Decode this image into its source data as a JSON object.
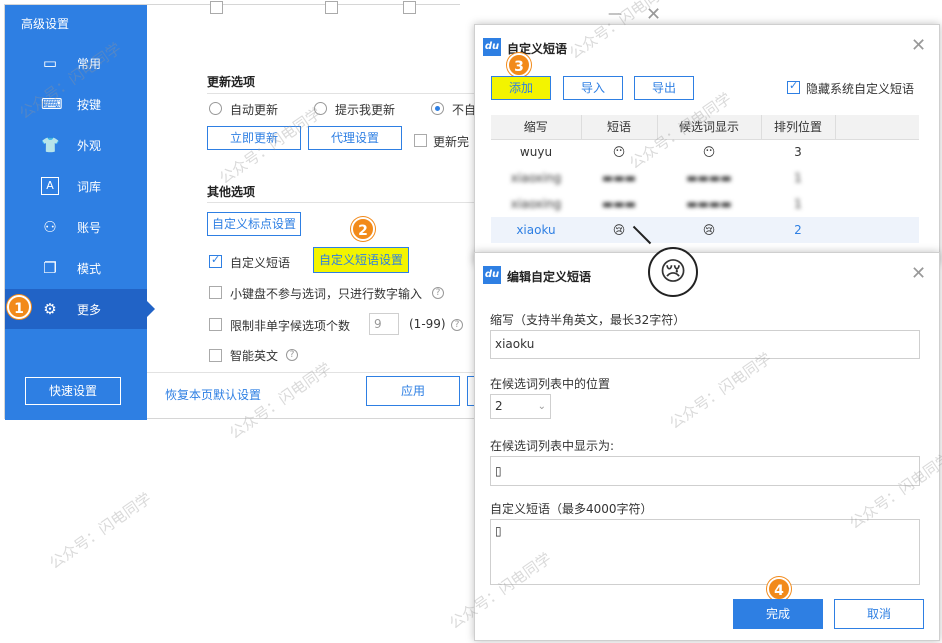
{
  "sidebar": {
    "title": "高级设置",
    "items": [
      {
        "label": "常用",
        "icon": "monitor-icon"
      },
      {
        "label": "按键",
        "icon": "keyboard-icon"
      },
      {
        "label": "外观",
        "icon": "shirt-icon"
      },
      {
        "label": "词库",
        "icon": "dictionary-icon"
      },
      {
        "label": "账号",
        "icon": "user-icon"
      },
      {
        "label": "模式",
        "icon": "mode-icon"
      },
      {
        "label": "更多",
        "icon": "gear-icon"
      }
    ],
    "quick_settings": "快速设置"
  },
  "update": {
    "title": "更新选项",
    "opt_auto": "自动更新",
    "opt_prompt": "提示我更新",
    "opt_no": "不自",
    "update_now": "立即更新",
    "proxy": "代理设置",
    "update_done": "更新完"
  },
  "other": {
    "title": "其他选项",
    "punct_btn": "自定义标点设置",
    "custom_phrase": "自定义短语",
    "custom_phrase_btn": "自定义短语设置",
    "keypad": "小键盘不参与选词，只进行数字输入",
    "limit": "限制非单字候选项个数",
    "limit_value": "9",
    "limit_range": "(1-99)",
    "smart_en": "智能英文"
  },
  "footer": {
    "restore": "恢复本页默认设置",
    "apply": "应用"
  },
  "phrase_dialog": {
    "logo": "du",
    "title": "自定义短语",
    "add": "添加",
    "import": "导入",
    "export": "导出",
    "hide_system": "隐藏系统自定义短语",
    "columns": [
      "缩写",
      "短语",
      "候选词显示",
      "排列位置"
    ],
    "rows": [
      {
        "abbr": "wuyu",
        "phrase": "😶",
        "display": "😶",
        "pos": "3"
      },
      {
        "abbr": "xiaoxing",
        "phrase": "",
        "display": "",
        "pos": "1"
      },
      {
        "abbr": "xiaoxing",
        "phrase": "",
        "display": "",
        "pos": "1"
      },
      {
        "abbr": "xiaoku",
        "phrase": "😢",
        "display": "😢",
        "pos": "2"
      }
    ]
  },
  "edit_dialog": {
    "logo": "du",
    "title": "编辑自定义短语",
    "abbr_label": "缩写（支持半角英文，最长32字符）",
    "abbr_value": "xiaoku",
    "pos_label": "在候选词列表中的位置",
    "pos_value": "2",
    "display_label": "在候选词列表中显示为:",
    "display_value": "▯",
    "phrase_label": "自定义短语（最多4000字符）",
    "phrase_value": "▯",
    "done": "完成",
    "cancel": "取消"
  },
  "badges": [
    "1",
    "2",
    "3",
    "4"
  ],
  "watermark": "公众号：闪电同学",
  "colors": {
    "accent": "#2e7fe3",
    "highlight": "#f3f400",
    "badge": "#f28a1a"
  }
}
